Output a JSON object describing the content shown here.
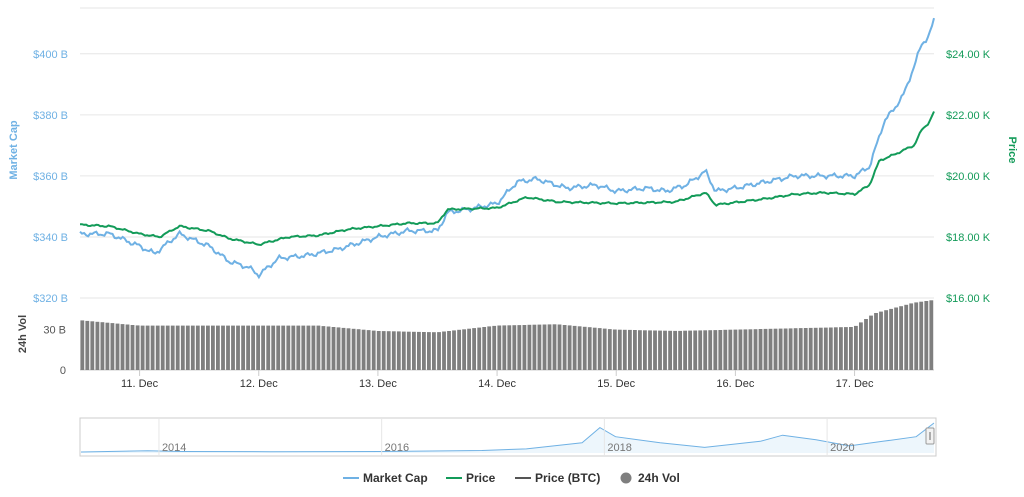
{
  "colors": {
    "market_cap": "#6fb1e4",
    "price": "#139b59",
    "price_btc": "#555555",
    "volume": "#7f7f7f",
    "grid": "#e6e6e6",
    "axis_text": "#555555"
  },
  "chart_data": {
    "type": "line",
    "x_ticks": [
      "11. Dec",
      "12. Dec",
      "13. Dec",
      "14. Dec",
      "15. Dec",
      "16. Dec",
      "17. Dec"
    ],
    "x_range": [
      "2020-12-10T12:00",
      "2020-12-17T16:00"
    ],
    "left_axis": {
      "label": "Market Cap",
      "ticks": [
        "$320 B",
        "$340 B",
        "$360 B",
        "$380 B",
        "$400 B"
      ],
      "range": [
        320,
        415
      ]
    },
    "right_axis": {
      "label": "Price",
      "ticks": [
        "$16.00 K",
        "$18.00 K",
        "$20.00 K",
        "$22.00 K",
        "$24.00 K"
      ],
      "range": [
        16000,
        25500
      ]
    },
    "volume_axis": {
      "label": "24h Vol",
      "ticks": [
        "0",
        "30 B"
      ],
      "range": [
        0,
        52
      ]
    },
    "series": [
      {
        "name": "Market Cap",
        "unit": "B",
        "points": [
          [
            "2020-12-10T12:00",
            341
          ],
          [
            "2020-12-10T18:00",
            341
          ],
          [
            "2020-12-11T00:00",
            337
          ],
          [
            "2020-12-11T03:00",
            334.5
          ],
          [
            "2020-12-11T08:00",
            341
          ],
          [
            "2020-12-11T14:00",
            337
          ],
          [
            "2020-12-11T18:00",
            332
          ],
          [
            "2020-12-11T22:00",
            330
          ],
          [
            "2020-12-12T00:00",
            327.5
          ],
          [
            "2020-12-12T04:00",
            333
          ],
          [
            "2020-12-12T10:00",
            334
          ],
          [
            "2020-12-12T16:00",
            336
          ],
          [
            "2020-12-12T20:00",
            338
          ],
          [
            "2020-12-13T00:00",
            340
          ],
          [
            "2020-12-13T06:00",
            342
          ],
          [
            "2020-12-13T12:00",
            342
          ],
          [
            "2020-12-13T14:00",
            348
          ],
          [
            "2020-12-13T18:00",
            349
          ],
          [
            "2020-12-14T00:00",
            351
          ],
          [
            "2020-12-14T04:00",
            358
          ],
          [
            "2020-12-14T08:00",
            359
          ],
          [
            "2020-12-14T14:00",
            356
          ],
          [
            "2020-12-14T20:00",
            357
          ],
          [
            "2020-12-15T00:00",
            355
          ],
          [
            "2020-12-15T06:00",
            356
          ],
          [
            "2020-12-15T10:00",
            355
          ],
          [
            "2020-12-15T14:00",
            357
          ],
          [
            "2020-12-15T18:00",
            361.5
          ],
          [
            "2020-12-15T20:00",
            355
          ],
          [
            "2020-12-16T00:00",
            356
          ],
          [
            "2020-12-16T06:00",
            358
          ],
          [
            "2020-12-16T12:00",
            360
          ],
          [
            "2020-12-16T18:00",
            360
          ],
          [
            "2020-12-17T00:00",
            360
          ],
          [
            "2020-12-17T03:00",
            363
          ],
          [
            "2020-12-17T06:00",
            378
          ],
          [
            "2020-12-17T08:00",
            382
          ],
          [
            "2020-12-17T10:00",
            387
          ],
          [
            "2020-12-17T12:00",
            396
          ],
          [
            "2020-12-17T13:30",
            403
          ],
          [
            "2020-12-17T15:00",
            406
          ],
          [
            "2020-12-17T16:00",
            411
          ]
        ]
      },
      {
        "name": "Price",
        "unit": "K",
        "points": [
          [
            "2020-12-10T12:00",
            18.4
          ],
          [
            "2020-12-10T18:00",
            18.35
          ],
          [
            "2020-12-11T00:00",
            18.1
          ],
          [
            "2020-12-11T04:00",
            18.0
          ],
          [
            "2020-12-11T08:00",
            18.35
          ],
          [
            "2020-12-11T14:00",
            18.2
          ],
          [
            "2020-12-11T18:00",
            17.95
          ],
          [
            "2020-12-12T00:00",
            17.75
          ],
          [
            "2020-12-12T06:00",
            18.0
          ],
          [
            "2020-12-12T12:00",
            18.05
          ],
          [
            "2020-12-12T18:00",
            18.25
          ],
          [
            "2020-12-13T00:00",
            18.35
          ],
          [
            "2020-12-13T06:00",
            18.45
          ],
          [
            "2020-12-13T12:00",
            18.45
          ],
          [
            "2020-12-13T14:00",
            18.9
          ],
          [
            "2020-12-14T00:00",
            18.95
          ],
          [
            "2020-12-14T06:00",
            19.3
          ],
          [
            "2020-12-14T12:00",
            19.15
          ],
          [
            "2020-12-15T00:00",
            19.1
          ],
          [
            "2020-12-15T12:00",
            19.15
          ],
          [
            "2020-12-15T18:00",
            19.45
          ],
          [
            "2020-12-15T20:00",
            19.05
          ],
          [
            "2020-12-16T06:00",
            19.25
          ],
          [
            "2020-12-16T12:00",
            19.4
          ],
          [
            "2020-12-16T18:00",
            19.45
          ],
          [
            "2020-12-17T00:00",
            19.4
          ],
          [
            "2020-12-17T03:00",
            19.7
          ],
          [
            "2020-12-17T05:00",
            20.5
          ],
          [
            "2020-12-17T08:00",
            20.7
          ],
          [
            "2020-12-17T12:00",
            21.0
          ],
          [
            "2020-12-17T13:30",
            21.5
          ],
          [
            "2020-12-17T15:00",
            21.75
          ],
          [
            "2020-12-17T16:00",
            22.1
          ]
        ]
      },
      {
        "name": "24h Vol",
        "unit": "B",
        "points": [
          [
            "2020-12-10T12:00",
            37
          ],
          [
            "2020-12-11T00:00",
            33
          ],
          [
            "2020-12-11T12:00",
            33
          ],
          [
            "2020-12-12T00:00",
            33
          ],
          [
            "2020-12-12T12:00",
            33
          ],
          [
            "2020-12-13T00:00",
            29
          ],
          [
            "2020-12-13T12:00",
            28
          ],
          [
            "2020-12-14T00:00",
            33
          ],
          [
            "2020-12-14T12:00",
            34
          ],
          [
            "2020-12-15T00:00",
            30
          ],
          [
            "2020-12-15T12:00",
            29
          ],
          [
            "2020-12-16T00:00",
            30
          ],
          [
            "2020-12-16T12:00",
            31
          ],
          [
            "2020-12-17T00:00",
            32
          ],
          [
            "2020-12-17T04:00",
            42
          ],
          [
            "2020-12-17T09:00",
            47
          ],
          [
            "2020-12-17T12:00",
            50
          ],
          [
            "2020-12-17T16:00",
            52
          ]
        ]
      }
    ],
    "navigator": {
      "year_labels": [
        "2014",
        "2016",
        "2018",
        "2020"
      ],
      "points": [
        [
          2013.3,
          0.0
        ],
        [
          2013.9,
          0.4
        ],
        [
          2014.2,
          0.15
        ],
        [
          2015.0,
          0.1
        ],
        [
          2016.0,
          0.15
        ],
        [
          2016.9,
          0.5
        ],
        [
          2017.3,
          1.0
        ],
        [
          2017.8,
          3.0
        ],
        [
          2017.96,
          8.0
        ],
        [
          2018.1,
          5.0
        ],
        [
          2018.5,
          3.0
        ],
        [
          2018.9,
          1.5
        ],
        [
          2019.4,
          3.5
        ],
        [
          2019.6,
          5.5
        ],
        [
          2019.9,
          4.0
        ],
        [
          2020.2,
          2.0
        ],
        [
          2020.5,
          3.5
        ],
        [
          2020.8,
          5.0
        ],
        [
          2020.96,
          9.5
        ]
      ],
      "range": [
        2013.3,
        2020.96
      ]
    }
  },
  "legend": [
    {
      "label": "Market Cap",
      "icon": "line-icon"
    },
    {
      "label": "Price",
      "icon": "line-icon"
    },
    {
      "label": "Price (BTC)",
      "icon": "line-icon"
    },
    {
      "label": "24h Vol",
      "icon": "circle-icon"
    }
  ]
}
